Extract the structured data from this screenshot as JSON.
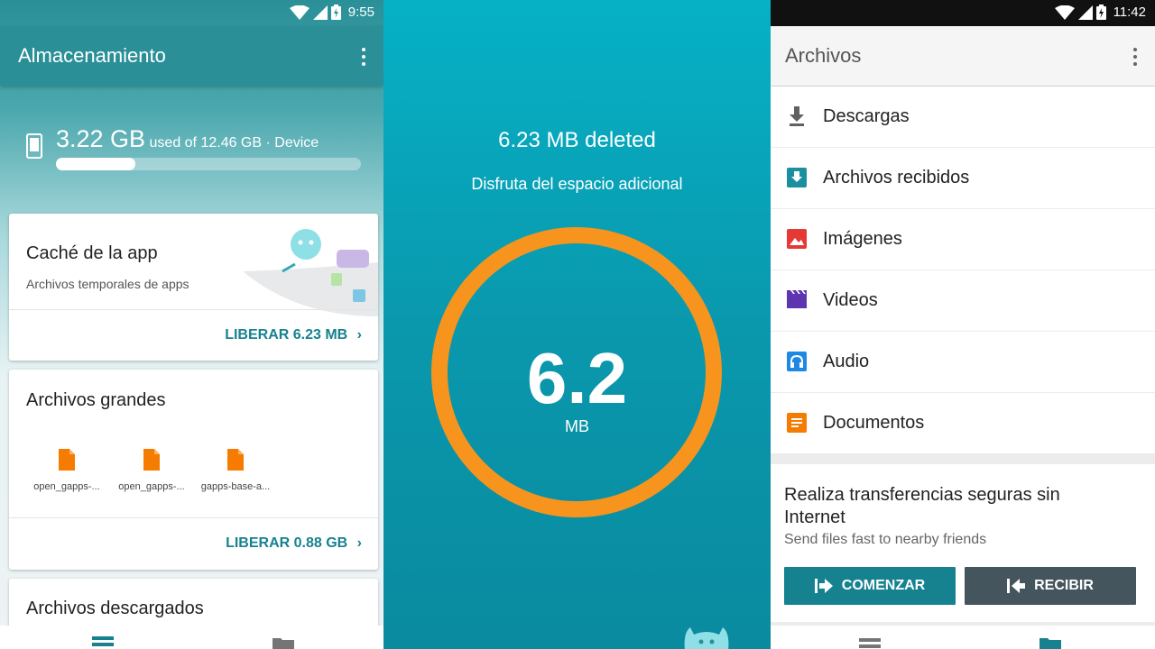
{
  "storage_screen": {
    "status_time": "9:55",
    "app_title": "Almacenamiento",
    "storage": {
      "used": "3.22 GB",
      "detail": "used of 12.46 GB · Device",
      "fraction": 0.26
    },
    "cards": {
      "cache": {
        "title": "Caché de la app",
        "subtitle": "Archivos temporales de apps",
        "action": "LIBERAR 6.23 MB"
      },
      "large_files": {
        "title": "Archivos grandes",
        "files": [
          "open_gapps-...",
          "open_gapps-...",
          "gapps-base-a..."
        ],
        "action": "LIBERAR 0.88 GB"
      },
      "downloads": {
        "title": "Archivos descargados"
      }
    }
  },
  "cleanup_screen": {
    "deleted": "6.23 MB deleted",
    "subtitle": "Disfruta del espacio adicional",
    "value": "6.2",
    "unit": "MB",
    "ring_color": "#f7941d"
  },
  "files_screen": {
    "status_time": "11:42",
    "app_title": "Archivos",
    "categories": [
      {
        "label": "Descargas",
        "icon": "download-icon",
        "color": "#616161"
      },
      {
        "label": "Archivos recibidos",
        "icon": "received-files-icon",
        "color": "#1a8fa0"
      },
      {
        "label": "Imágenes",
        "icon": "image-icon",
        "color": "#e53935"
      },
      {
        "label": "Videos",
        "icon": "video-icon",
        "color": "#5e35b1"
      },
      {
        "label": "Audio",
        "icon": "headphones-icon",
        "color": "#1e88e5"
      },
      {
        "label": "Documentos",
        "icon": "document-icon",
        "color": "#f57c00"
      }
    ],
    "promo": {
      "title": "Realiza transferencias seguras sin Internet",
      "subtitle": "Send files fast to nearby friends",
      "start_button": "COMENZAR",
      "receive_button": "RECIBIR"
    }
  },
  "colors": {
    "teal": "#17828f",
    "file_orange": "#f57c00",
    "receive_gray": "#45555e"
  }
}
